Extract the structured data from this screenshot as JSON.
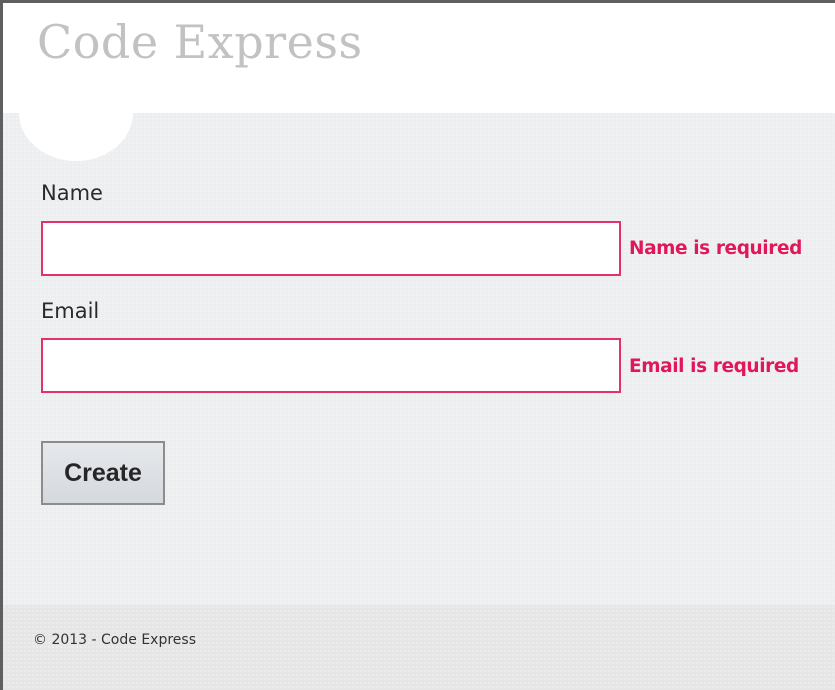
{
  "header": {
    "site_title": "Code Express"
  },
  "form": {
    "name_label": "Name",
    "name_value": "",
    "name_error": "Name is required",
    "email_label": "Email",
    "email_value": "",
    "email_error": "Email is required",
    "create_button_label": "Create"
  },
  "footer": {
    "copyright": "© 2013 - Code Express"
  },
  "colors": {
    "error": "#e0185a",
    "error_border": "#e1336a",
    "title": "#c2c2c2",
    "background": "#eceef0"
  }
}
